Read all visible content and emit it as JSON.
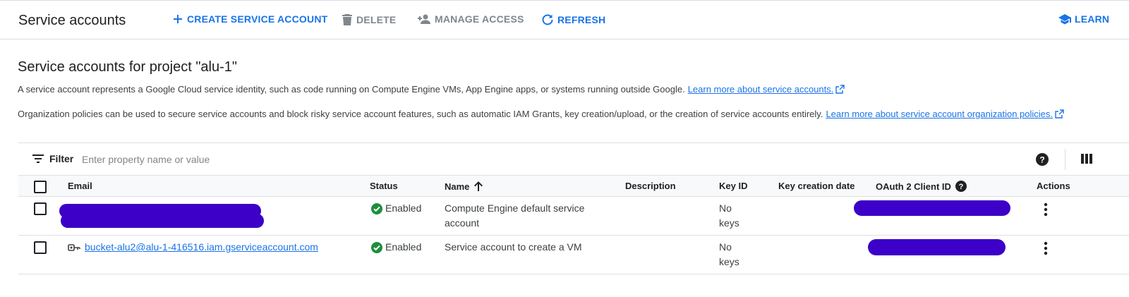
{
  "toolbar": {
    "title": "Service accounts",
    "create_label": "CREATE SERVICE ACCOUNT",
    "delete_label": "DELETE",
    "manage_label": "MANAGE ACCESS",
    "refresh_label": "REFRESH",
    "learn_label": "LEARN"
  },
  "page": {
    "heading": "Service accounts for project \"alu-1\"",
    "desc1": "A service account represents a Google Cloud service identity, such as code running on Compute Engine VMs, App Engine apps, or systems running outside Google.",
    "desc1_link": "Learn more about service accounts.",
    "desc2": "Organization policies can be used to secure service accounts and block risky service account features, such as automatic IAM Grants, key creation/upload, or the creation of service accounts entirely.",
    "desc2_link": "Learn more about service account organization policies."
  },
  "filter": {
    "label": "Filter",
    "placeholder": "Enter property name or value"
  },
  "table": {
    "headers": {
      "email": "Email",
      "status": "Status",
      "name": "Name",
      "description": "Description",
      "key_id": "Key ID",
      "key_date": "Key creation date",
      "oauth": "OAuth 2 Client ID",
      "actions": "Actions"
    },
    "rows": [
      {
        "email": "",
        "status": "Enabled",
        "name_line1": "Compute Engine default service",
        "name_line2": "account",
        "key_line1": "No",
        "key_line2": "keys"
      },
      {
        "email": "bucket-alu2@alu-1-416516.iam.gserviceaccount.com",
        "status": "Enabled",
        "name_line1": "Service account to create a VM",
        "key_line1": "No",
        "key_line2": "keys"
      }
    ]
  },
  "colors": {
    "accent": "#1a73e8",
    "enabled": "#1e8e3e",
    "redaction": "#3c00c8"
  },
  "icons": [
    "plus-icon",
    "trash-icon",
    "person-add-icon",
    "refresh-icon",
    "school-icon",
    "filter-icon",
    "help-icon",
    "columns-icon",
    "sort-up-icon",
    "check-circle-icon",
    "key-icon",
    "more-vert-icon",
    "external-link-icon"
  ]
}
